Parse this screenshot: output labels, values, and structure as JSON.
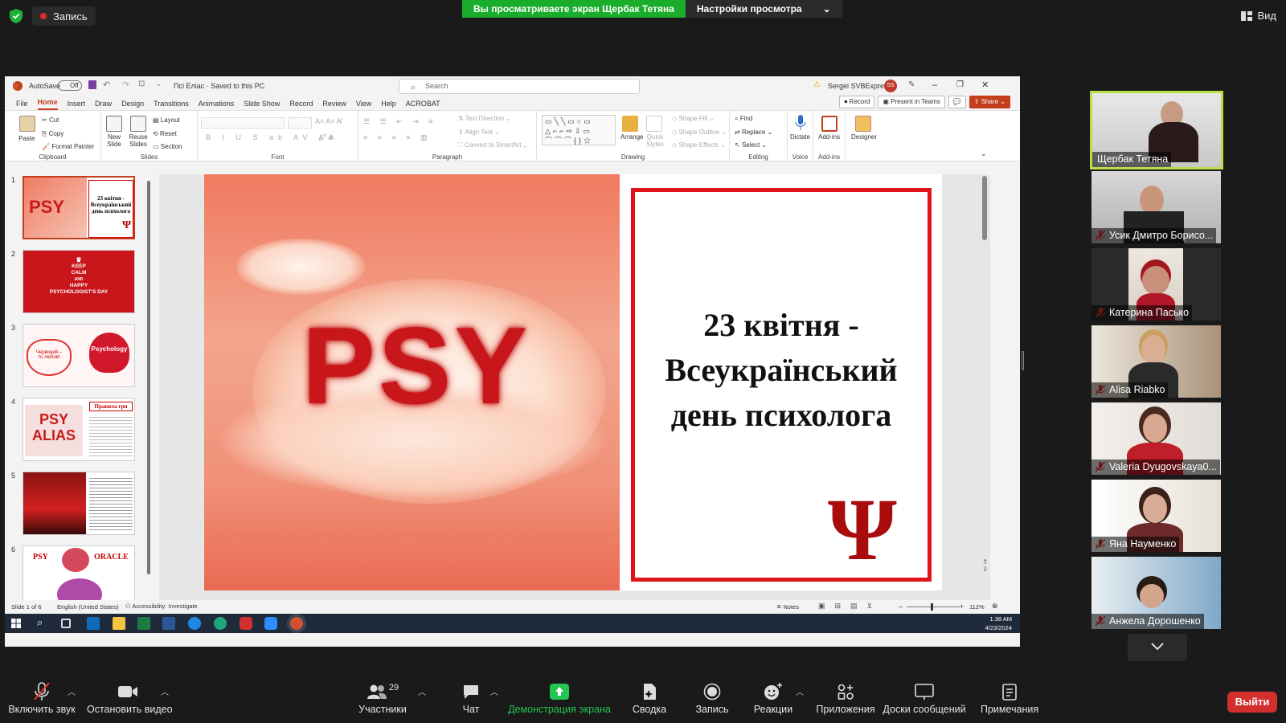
{
  "zoom": {
    "recording_label": "Запись",
    "share_banner": "Вы просматриваете экран Щербак Тетяна",
    "view_settings": "Настройки просмотра",
    "view_label": "Вид",
    "exit_label": "Выйти",
    "participants_count": "29",
    "bottom": {
      "mute": "Включить звук",
      "video": "Остановить видео",
      "participants": "Участники",
      "chat": "Чат",
      "share": "Демонстрация экрана",
      "summary": "Сводка",
      "record": "Запись",
      "reactions": "Реакции",
      "apps": "Приложения",
      "whiteboards": "Доски сообщений",
      "notes": "Примечания"
    },
    "participants": [
      {
        "name": "Щербак Тетяна",
        "active": true,
        "muted": false
      },
      {
        "name": "Усик Дмитро Борисо...",
        "active": false,
        "muted": true
      },
      {
        "name": "Катерина Пасько",
        "active": false,
        "muted": true
      },
      {
        "name": "Alisa Riabko",
        "active": false,
        "muted": true
      },
      {
        "name": "Valeria Dyugovskaya0...",
        "active": false,
        "muted": true
      },
      {
        "name": "Яна Науменко",
        "active": false,
        "muted": true
      },
      {
        "name": "Анжела Дорошенко",
        "active": false,
        "muted": true
      }
    ]
  },
  "ppt": {
    "autosave": "AutoSave",
    "autosave_state": "Off",
    "doc_title": "Псі Еліас · Saved to this PC",
    "search_placeholder": "Search",
    "user": "Sergei SVBExpress",
    "user_initials": "SS",
    "tabs": [
      "File",
      "Home",
      "Insert",
      "Draw",
      "Design",
      "Transitions",
      "Animations",
      "Slide Show",
      "Record",
      "Review",
      "View",
      "Help",
      "ACROBAT"
    ],
    "record_btn": "Record",
    "teams_btn": "Present in Teams",
    "share_btn": "Share",
    "ribbon": {
      "paste": "Paste",
      "cut": "Cut",
      "copy": "Copy",
      "format_painter": "Format Painter",
      "clipboard": "Clipboard",
      "new_slide": "New Slide",
      "reuse_slides": "Reuse Slides",
      "layout": "Layout",
      "reset": "Reset",
      "section": "Section",
      "slides": "Slides",
      "font": "Font",
      "paragraph": "Paragraph",
      "text_direction": "Text Direction",
      "align_text": "Align Text",
      "convert_smartart": "Convert to SmartArt",
      "arrange": "Arrange",
      "quick_styles": "Quick Styles",
      "shape_fill": "Shape Fill",
      "shape_outline": "Shape Outline",
      "shape_effects": "Shape Effects",
      "drawing": "Drawing",
      "find": "Find",
      "replace": "Replace",
      "select": "Select",
      "editing": "Editing",
      "dictate": "Dictate",
      "voice": "Voice",
      "addins": "Add-ins",
      "addins_group": "Add-ins",
      "designer": "Designer"
    },
    "slide_title": "23 квітня - Всеукраїнський день психолога",
    "slide_title_lines": [
      "23 квітня -",
      "Всеукраїнський",
      "день психолога"
    ],
    "psy_text": "PSY",
    "psi_symbol": "Ψ",
    "thumbs": [
      {
        "num": "1",
        "lines": [
          "23 квітня -",
          "Всеукраїнський",
          "день психолога"
        ]
      },
      {
        "num": "2",
        "lines": [
          "KEEP",
          "CALM",
          "AND",
          "HAPPY",
          "PSYCHOLOGIST'S DAY"
        ]
      },
      {
        "num": "3",
        "lines": [
          "Червоний –",
          "то любов!",
          "Psychology"
        ]
      },
      {
        "num": "4",
        "lines": [
          "PSY",
          "ALIAS",
          "Правила гри"
        ]
      },
      {
        "num": "5",
        "lines": []
      },
      {
        "num": "6",
        "lines": [
          "PSY",
          "ORACLE"
        ]
      }
    ],
    "status": {
      "slide_of": "Slide 1 of 6",
      "language": "English (United States)",
      "accessibility": "Accessibility: Investigate",
      "notes": "Notes",
      "zoom": "112%"
    },
    "clock_time": "1:38 AM",
    "clock_date": "4/23/2024"
  }
}
